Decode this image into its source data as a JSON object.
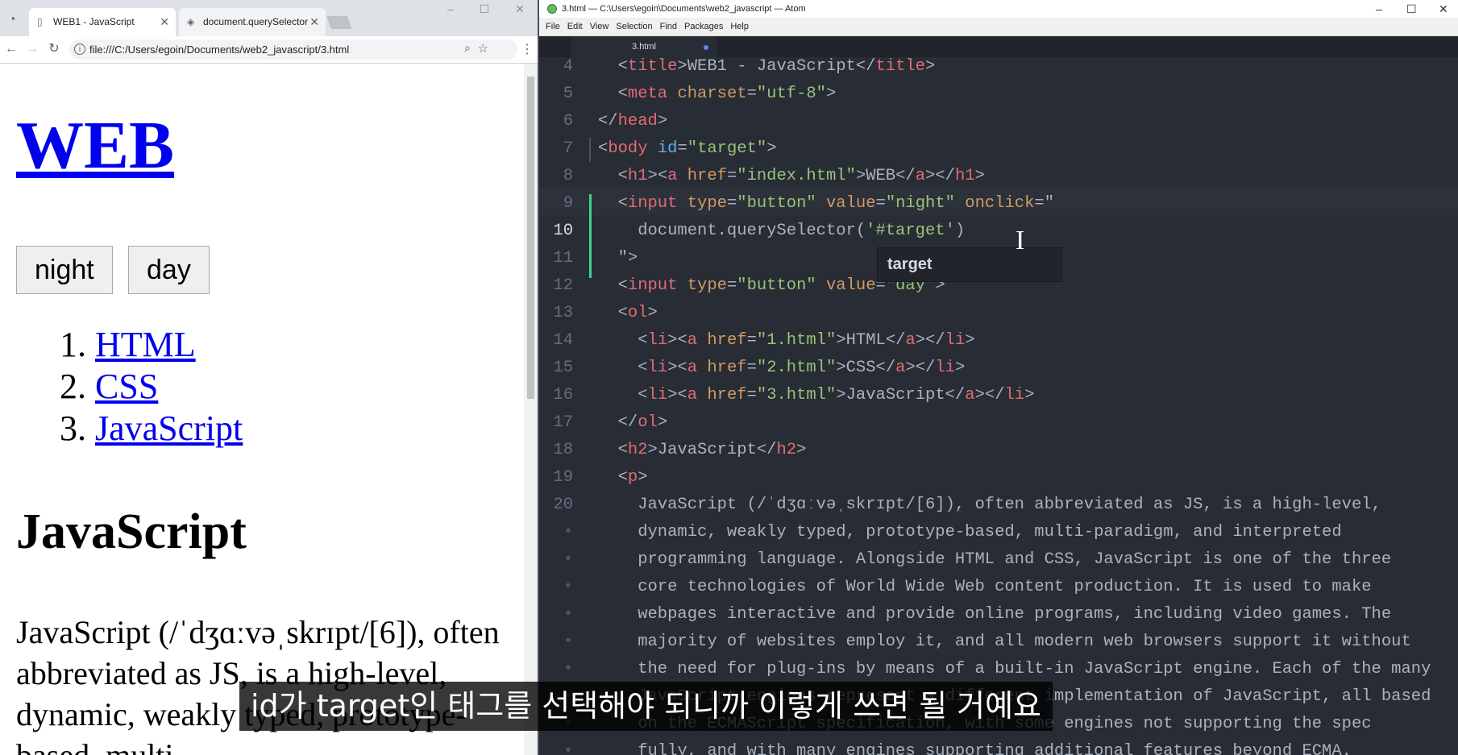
{
  "chrome": {
    "tabs": [
      {
        "title": "WEB1 - JavaScript",
        "close": "✕"
      },
      {
        "title": "document.querySelector",
        "close": "✕"
      }
    ],
    "window_controls": {
      "minimize": "–",
      "maximize": "☐",
      "close": "✕"
    },
    "url": "file:///C:/Users/egoin/Documents/web2_javascript/3.html",
    "page": {
      "h1": "WEB",
      "buttons": [
        "night",
        "day"
      ],
      "list": [
        {
          "num": "1.",
          "label": "HTML"
        },
        {
          "num": "2.",
          "label": "CSS"
        },
        {
          "num": "3.",
          "label": "JavaScript"
        }
      ],
      "h2": "JavaScript",
      "paragraph": "JavaScript (/ˈdʒɑːvəˌskrɪpt/[6]), often abbreviated as JS, is a high-level, dynamic, weakly typed, prototype-based, multi-"
    }
  },
  "atom": {
    "title": "3.html — C:\\Users\\egoin\\Documents\\web2_javascript — Atom",
    "window_controls": {
      "minimize": "–",
      "maximize": "☐",
      "close": "✕"
    },
    "menu": [
      "File",
      "Edit",
      "View",
      "Selection",
      "Find",
      "Packages",
      "Help"
    ],
    "tab": "3.html",
    "line_numbers": [
      "4",
      "5",
      "6",
      "7",
      "8",
      "9",
      "10",
      "11",
      "12",
      "13",
      "14",
      "15",
      "16",
      "17",
      "18",
      "19",
      "20",
      "•",
      "•",
      "•",
      "•",
      "•",
      "•",
      "•",
      "•",
      "•"
    ],
    "code_lines": [
      "  <title>WEB1 - JavaScript</title>",
      "  <meta charset=\"utf-8\">",
      "</head>",
      "<body id=\"target\">",
      "  <h1><a href=\"index.html\">WEB</a></h1>",
      "  <input type=\"button\" value=\"night\" onclick=\"",
      "    document.querySelector('#target')",
      "  \">",
      "  <input type=\"button\" value=\"day\">",
      "  <ol>",
      "    <li><a href=\"1.html\">HTML</a></li>",
      "    <li><a href=\"2.html\">CSS</a></li>",
      "    <li><a href=\"3.html\">JavaScript</a></li>",
      "  </ol>",
      "  <h2>JavaScript</h2>",
      "  <p>",
      "    JavaScript (/ˈdʒɑːvəˌskrɪpt/[6]), often abbreviated as JS, is a high-level,",
      "    dynamic, weakly typed, prototype-based, multi-paradigm, and interpreted",
      "    programming language. Alongside HTML and CSS, JavaScript is one of the three",
      "    core technologies of World Wide Web content production. It is used to make",
      "    webpages interactive and provide online programs, including video games. The",
      "    majority of websites employ it, and all modern web browsers support it without",
      "    the need for plug-ins by means of a built-in JavaScript engine. Each of the many",
      "    JavaScript engines represent a different implementation of JavaScript, all based",
      "    on the ECMAScript specification, with some engines not supporting the spec",
      "    fully, and with many engines supporting additional features beyond ECMA."
    ],
    "autocomplete": "target"
  },
  "subtitle": "id가 target인 태그를 선택해야 되니까 이렇게 쓰면 될 거예요"
}
